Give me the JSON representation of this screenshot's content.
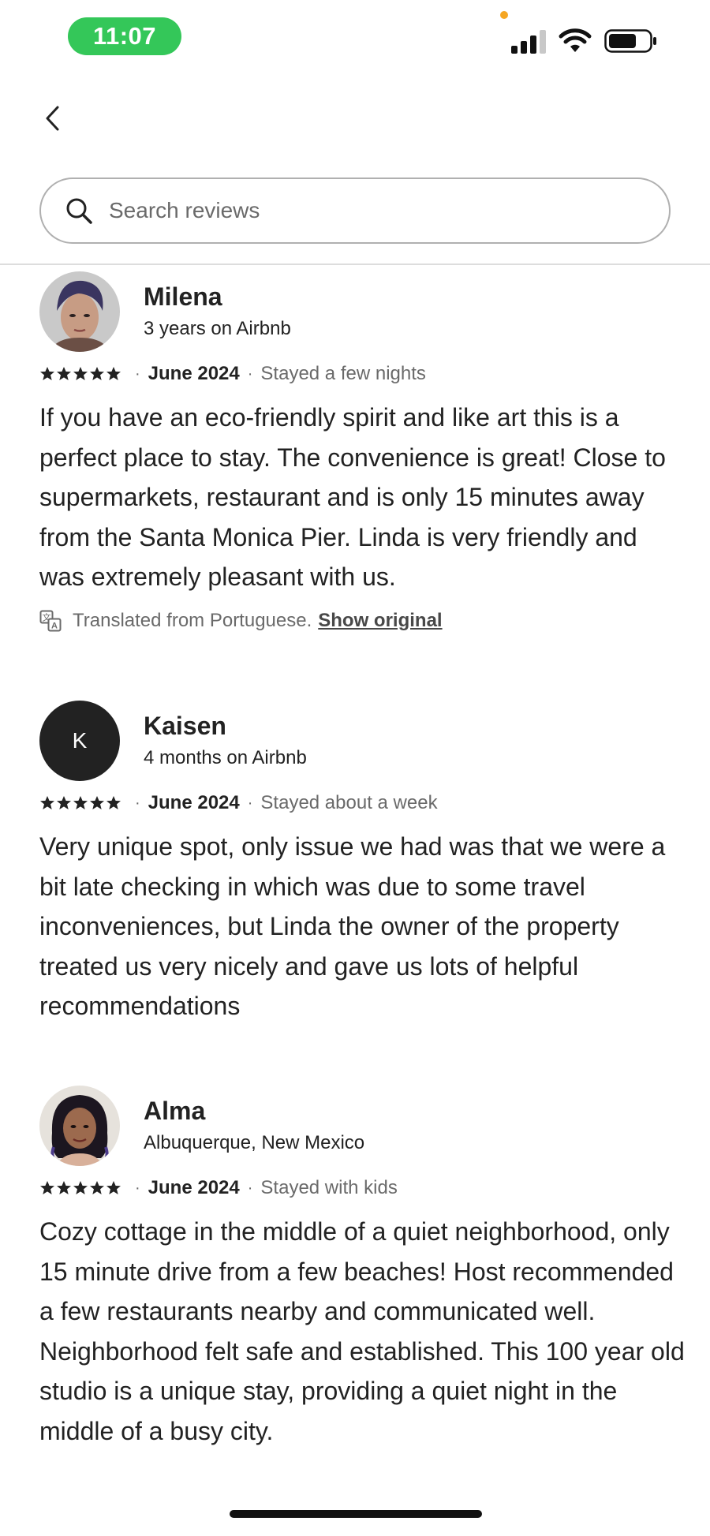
{
  "status_bar": {
    "time": "11:07"
  },
  "search": {
    "placeholder": "Search reviews"
  },
  "reviews": [
    {
      "name": "Milena",
      "subtitle": "3 years on Airbnb",
      "avatar": "photo",
      "rating": 5,
      "date": "June 2024",
      "stay": "Stayed a few nights",
      "text": "If you have an eco-friendly spirit and like art this is a perfect place to stay. The convenience is great! Close to supermarkets, restaurant and is only 15 minutes away from the Santa Monica Pier. Linda is very friendly and was extremely pleasant with us.",
      "translation_note": "Translated from Portuguese.",
      "show_original_label": "Show original"
    },
    {
      "name": "Kaisen",
      "subtitle": "4 months on Airbnb",
      "avatar_initial": "K",
      "rating": 5,
      "date": "June 2024",
      "stay": "Stayed about a week",
      "text": "Very unique spot, only issue we had was that we were a bit late checking in which was due to some travel inconveniences, but Linda the owner of the property treated us very nicely and gave us lots of helpful recommendations"
    },
    {
      "name": "Alma",
      "subtitle": "Albuquerque, New Mexico",
      "avatar": "photo",
      "rating": 5,
      "date": "June 2024",
      "stay": "Stayed with kids",
      "text": "Cozy cottage in the middle of a quiet neighborhood, only 15 minute drive from a few beaches! Host recommended a few restaurants nearby and communicated well. Neighborhood felt safe and established. This 100 year old studio is a unique stay, providing a quiet night in the middle of a busy city."
    }
  ],
  "colors": {
    "text": "#222222",
    "muted": "#6a6a6a",
    "time_pill": "#34c759",
    "border": "#b0b0b0"
  }
}
